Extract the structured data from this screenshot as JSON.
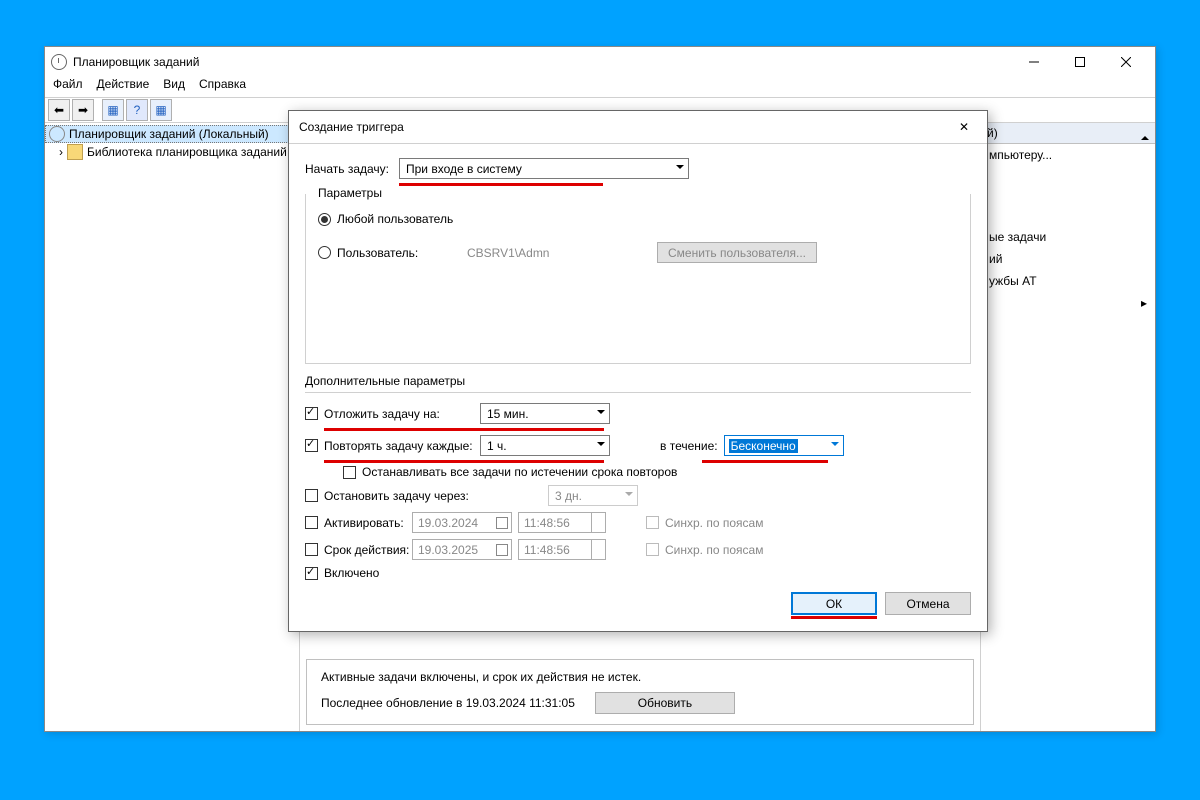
{
  "mainWindow": {
    "title": "Планировщик заданий",
    "menu": {
      "file": "Файл",
      "action": "Действие",
      "view": "Вид",
      "help": "Справка"
    },
    "tree": {
      "root": "Планировщик заданий (Локальный)",
      "child": "Библиотека планировщика заданий"
    },
    "rightPane": {
      "headerSuffix": "й)",
      "item1": "мпьютеру...",
      "item2": "ые задачи",
      "item3": "ий",
      "item4": "ужбы AT"
    },
    "status": {
      "line1": "Активные задачи включены, и срок их действия не истек.",
      "line2": "Последнее обновление в 19.03.2024 11:31:05",
      "updateBtn": "Обновить"
    }
  },
  "modal": {
    "title": "Создание триггера",
    "startLabel": "Начать задачу:",
    "startValue": "При входе в систему",
    "paramsLegend": "Параметры",
    "radio1": "Любой пользователь",
    "radio2": "Пользователь:",
    "userValue": "CBSRV1\\Admn",
    "changeUserBtn": "Сменить пользователя...",
    "advLegend": "Дополнительные параметры",
    "delay": {
      "label": "Отложить задачу на:",
      "value": "15 мин."
    },
    "repeat": {
      "label": "Повторять задачу каждые:",
      "value": "1 ч.",
      "durLabel": "в течение:",
      "durValue": "Бесконечно"
    },
    "stopAll": "Останавливать все задачи по истечении срока повторов",
    "stopAfter": {
      "label": "Остановить задачу через:",
      "value": "3 дн."
    },
    "activate": {
      "label": "Активировать:",
      "date": "19.03.2024",
      "time": "11:48:56",
      "sync": "Синхр. по поясам"
    },
    "expire": {
      "label": "Срок действия:",
      "date": "19.03.2025",
      "time": "11:48:56",
      "sync": "Синхр. по поясам"
    },
    "enabled": "Включено",
    "ok": "ОК",
    "cancel": "Отмена"
  }
}
